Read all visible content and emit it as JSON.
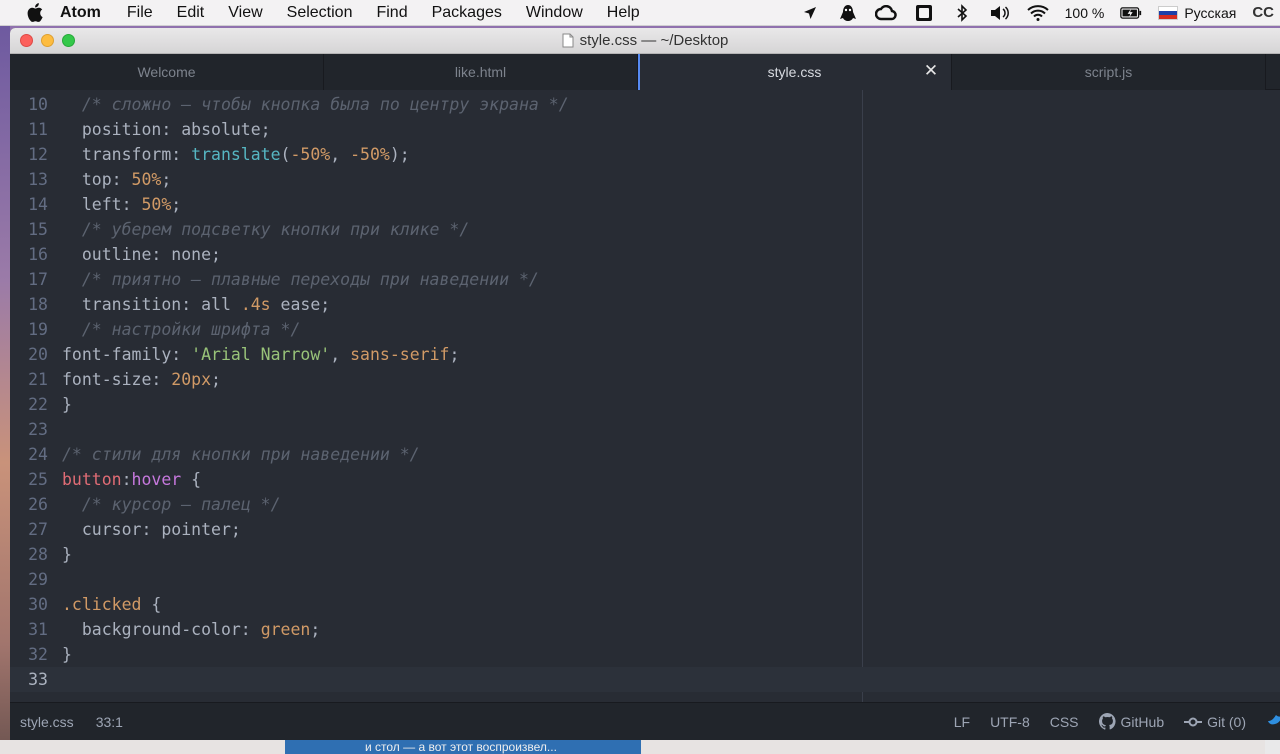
{
  "menubar": {
    "app_name": "Atom",
    "items": [
      "File",
      "Edit",
      "View",
      "Selection",
      "Find",
      "Packages",
      "Window",
      "Help"
    ],
    "battery": "100 %",
    "language": "Русская",
    "cc_label": "CC"
  },
  "window": {
    "title": "style.css — ~/Desktop"
  },
  "tabs": [
    {
      "label": "Welcome",
      "active": false
    },
    {
      "label": "like.html",
      "active": false
    },
    {
      "label": "style.css",
      "active": true
    },
    {
      "label": "script.js",
      "active": false
    }
  ],
  "editor": {
    "lines": [
      {
        "n": "10",
        "code": "  /* сложно — чтобы кнопка была по центру экрана */"
      },
      {
        "n": "11",
        "code": "  position: absolute;"
      },
      {
        "n": "12",
        "code": "  transform: translate(-50%, -50%);"
      },
      {
        "n": "13",
        "code": "  top: 50%;"
      },
      {
        "n": "14",
        "code": "  left: 50%;"
      },
      {
        "n": "15",
        "code": "  /* уберем подсветку кнопки при клике */"
      },
      {
        "n": "16",
        "code": "  outline: none;"
      },
      {
        "n": "17",
        "code": "  /* приятно — плавные переходы при наведении */"
      },
      {
        "n": "18",
        "code": "  transition: all .4s ease;"
      },
      {
        "n": "19",
        "code": "  /* настройки шрифта */"
      },
      {
        "n": "20",
        "code": "font-family: 'Arial Narrow', sans-serif;"
      },
      {
        "n": "21",
        "code": "font-size: 20px;"
      },
      {
        "n": "22",
        "code": "}"
      },
      {
        "n": "23",
        "code": ""
      },
      {
        "n": "24",
        "code": "/* стили для кнопки при наведении */"
      },
      {
        "n": "25",
        "code": "button:hover {"
      },
      {
        "n": "26",
        "code": "  /* курсор — палец */"
      },
      {
        "n": "27",
        "code": "  cursor: pointer;"
      },
      {
        "n": "28",
        "code": "}"
      },
      {
        "n": "29",
        "code": ""
      },
      {
        "n": "30",
        "code": ".clicked {"
      },
      {
        "n": "31",
        "code": "  background-color: green;"
      },
      {
        "n": "32",
        "code": "}"
      },
      {
        "n": "33",
        "code": ""
      }
    ]
  },
  "statusbar": {
    "file": "style.css",
    "cursor": "33:1",
    "line_ending": "LF",
    "encoding": "UTF-8",
    "grammar": "CSS",
    "github": "GitHub",
    "git": "Git (0)"
  },
  "behind_window_text": "и стол — а вот этот воспроизвел..."
}
